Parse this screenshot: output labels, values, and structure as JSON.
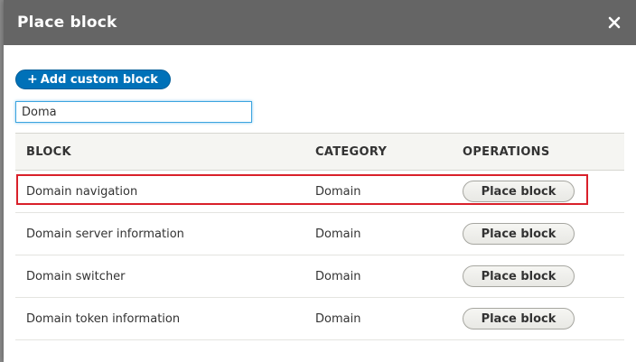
{
  "dialog": {
    "title": "Place block",
    "close_icon": "close-icon"
  },
  "toolbar": {
    "add_custom_block_label": "Add custom block",
    "add_icon": "plus-icon"
  },
  "filter": {
    "value": "Doma"
  },
  "table": {
    "headers": {
      "block": "BLOCK",
      "category": "CATEGORY",
      "operations": "OPERATIONS"
    },
    "rows": [
      {
        "block": "Domain navigation",
        "category": "Domain",
        "operation": "Place block",
        "highlighted": true
      },
      {
        "block": "Domain server information",
        "category": "Domain",
        "operation": "Place block",
        "highlighted": false
      },
      {
        "block": "Domain switcher",
        "category": "Domain",
        "operation": "Place block",
        "highlighted": false
      },
      {
        "block": "Domain token information",
        "category": "Domain",
        "operation": "Place block",
        "highlighted": false
      }
    ]
  },
  "colors": {
    "titlebar": "#656565",
    "primary_button": "#0071b8",
    "highlight_border": "#d9202a",
    "filter_focus": "#3ba4df"
  }
}
